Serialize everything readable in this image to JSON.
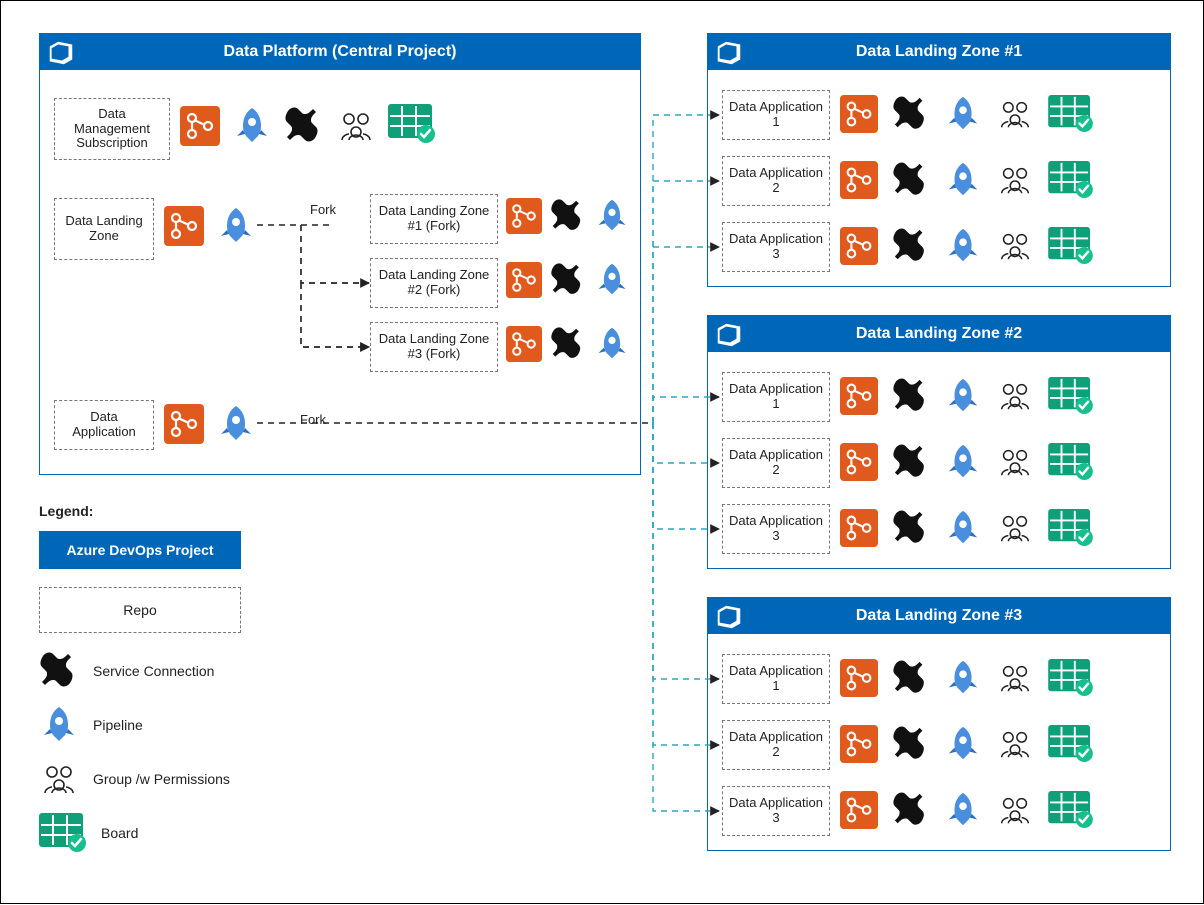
{
  "centralProject": {
    "title": "Data Platform (Central Project)",
    "repos": {
      "mgmt": "Data Management Subscription",
      "landing": "Data Landing Zone",
      "app": "Data Application",
      "forkLabel1": "Fork",
      "forkLabel2": "Fork",
      "fork1": "Data Landing Zone #1 (Fork)",
      "fork2": "Data Landing Zone #2 (Fork)",
      "fork3": "Data Landing Zone #3 (Fork)"
    }
  },
  "zones": [
    {
      "title": "Data Landing Zone #1",
      "apps": [
        "Data Application 1",
        "Data Application 2",
        "Data Application 3"
      ]
    },
    {
      "title": "Data Landing Zone #2",
      "apps": [
        "Data Application 1",
        "Data Application 2",
        "Data Application 3"
      ]
    },
    {
      "title": "Data Landing Zone #3",
      "apps": [
        "Data Application 1",
        "Data Application 2",
        "Data Application 3"
      ]
    }
  ],
  "legend": {
    "heading": "Legend:",
    "project": "Azure DevOps Project",
    "repo": "Repo",
    "service": "Service Connection",
    "pipeline": "Pipeline",
    "group": "Group /w Permissions",
    "board": "Board"
  },
  "colors": {
    "azure": "#0067b8",
    "repoOrange": "#e15a1d",
    "pipelineBlue": "#4a8ede",
    "boardGreen": "#0fa07a",
    "check": "#17bf8f"
  }
}
